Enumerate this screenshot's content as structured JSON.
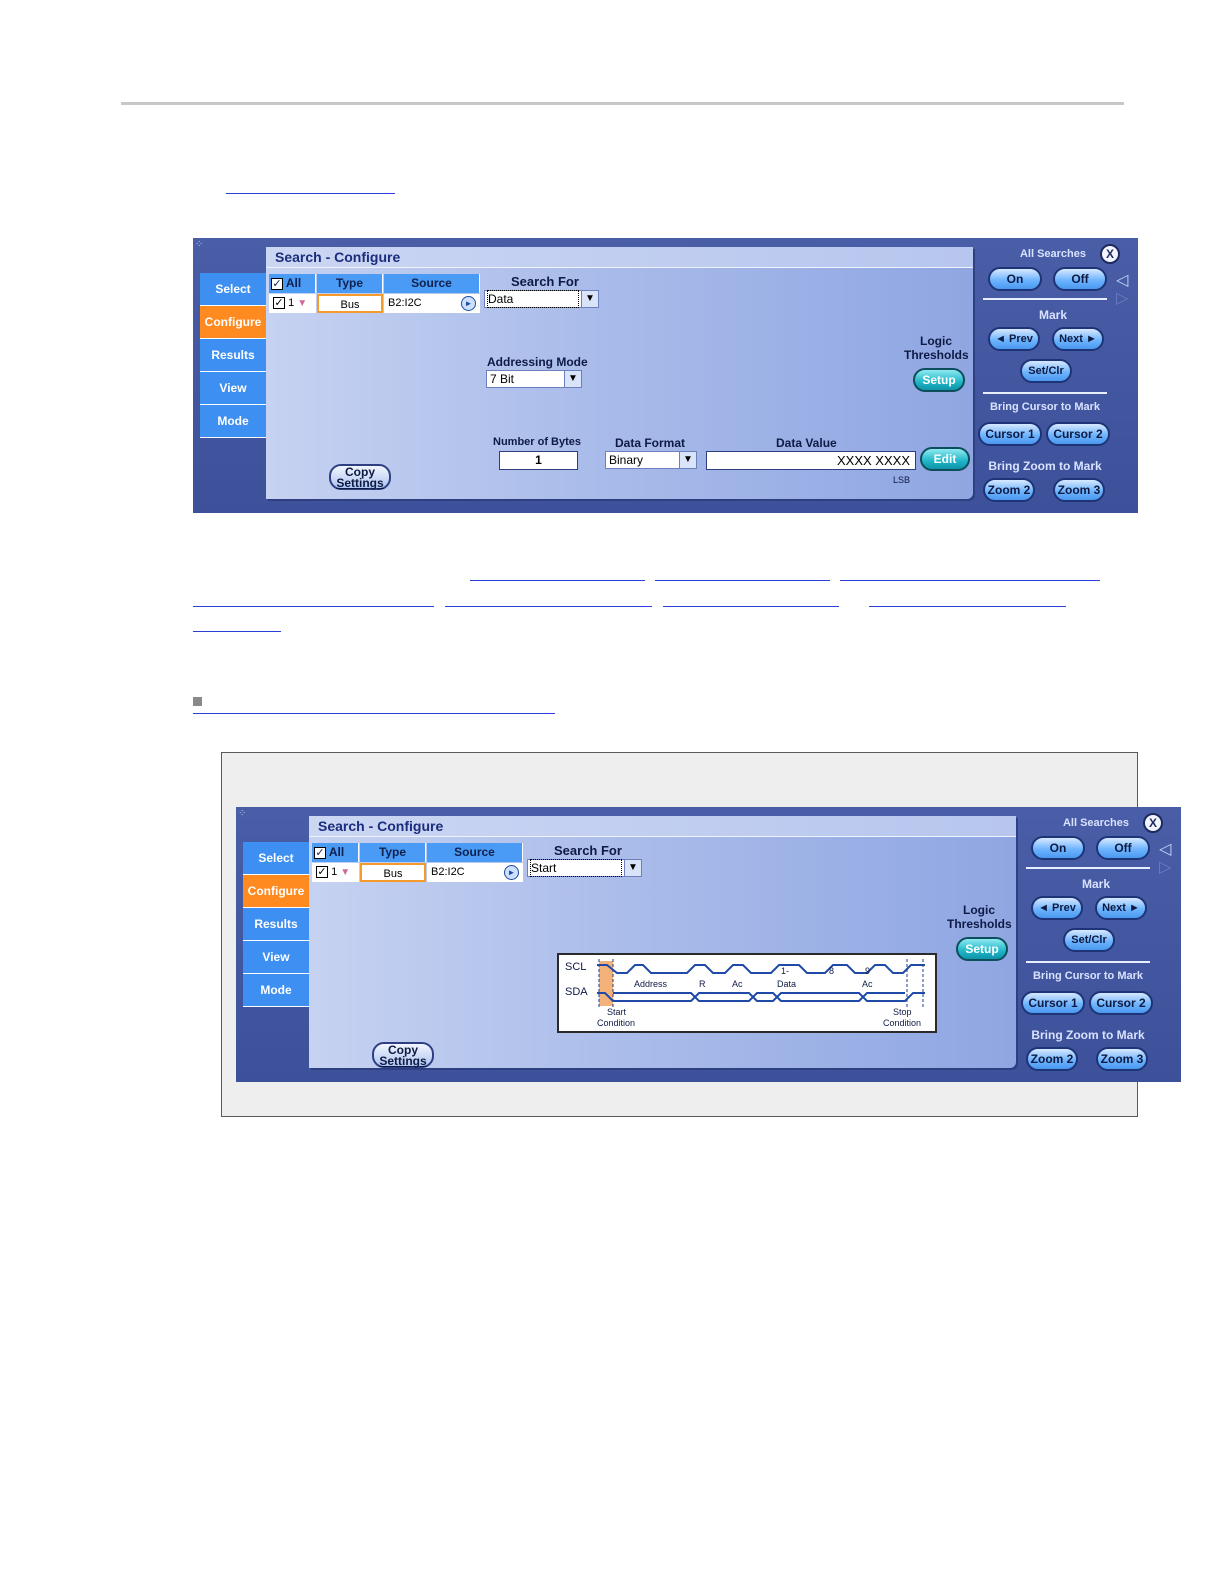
{
  "panel_top": {
    "title": "Search - Configure",
    "tabs": [
      "Select",
      "Configure",
      "Results",
      "View",
      "Mode"
    ],
    "grid": {
      "all": "All",
      "type": "Type",
      "source": "Source",
      "row_num": "1",
      "row_type": "Bus",
      "row_source": "B2:I2C"
    },
    "search_for_label": "Search For",
    "search_for_value": "Data",
    "addressing_label": "Addressing Mode",
    "addressing_value": "7 Bit",
    "logic_label_1": "Logic",
    "logic_label_2": "Thresholds",
    "setup": "Setup",
    "num_bytes_label": "Number of Bytes",
    "num_bytes_value": "1",
    "data_format_label": "Data Format",
    "data_format_value": "Binary",
    "data_value_label": "Data Value",
    "data_value": "XXXX XXXX",
    "lsb": "LSB",
    "edit": "Edit",
    "copy_1": "Copy",
    "copy_2": "Settings"
  },
  "panel_bottom": {
    "title": "Search - Configure",
    "tabs": [
      "Select",
      "Configure",
      "Results",
      "View",
      "Mode"
    ],
    "grid": {
      "all": "All",
      "type": "Type",
      "source": "Source",
      "row_num": "1",
      "row_type": "Bus",
      "row_source": "B2:I2C"
    },
    "search_for_label": "Search For",
    "search_for_value": "Start",
    "logic_label_1": "Logic",
    "logic_label_2": "Thresholds",
    "setup": "Setup",
    "copy_1": "Copy",
    "copy_2": "Settings",
    "timing": {
      "scl": "SCL",
      "sda": "SDA",
      "address": "Address",
      "r": "R",
      "ac1": "Ac",
      "data": "Data",
      "ac2": "Ac",
      "n1": "1-",
      "n8": "8",
      "n9": "9",
      "start_1": "Start",
      "start_2": "Condition",
      "stop_1": "Stop",
      "stop_2": "Condition"
    }
  },
  "right_panel": {
    "all_searches": "All Searches",
    "on": "On",
    "off": "Off",
    "mark": "Mark",
    "prev": "◄ Prev",
    "next": "Next ►",
    "setclr": "Set/Clr",
    "bring_cursor": "Bring Cursor to Mark",
    "cursor1": "Cursor 1",
    "cursor2": "Cursor 2",
    "bring_zoom": "Bring Zoom to Mark",
    "zoom2": "Zoom 2",
    "zoom3": "Zoom 3",
    "close": "X"
  },
  "colors": {
    "link": "#2a3fd6",
    "panel_bg": "#4256a2",
    "tab": "#3d8ff1",
    "tab_active": "#ff8a1f",
    "accent_teal": "#1fb6c8"
  }
}
